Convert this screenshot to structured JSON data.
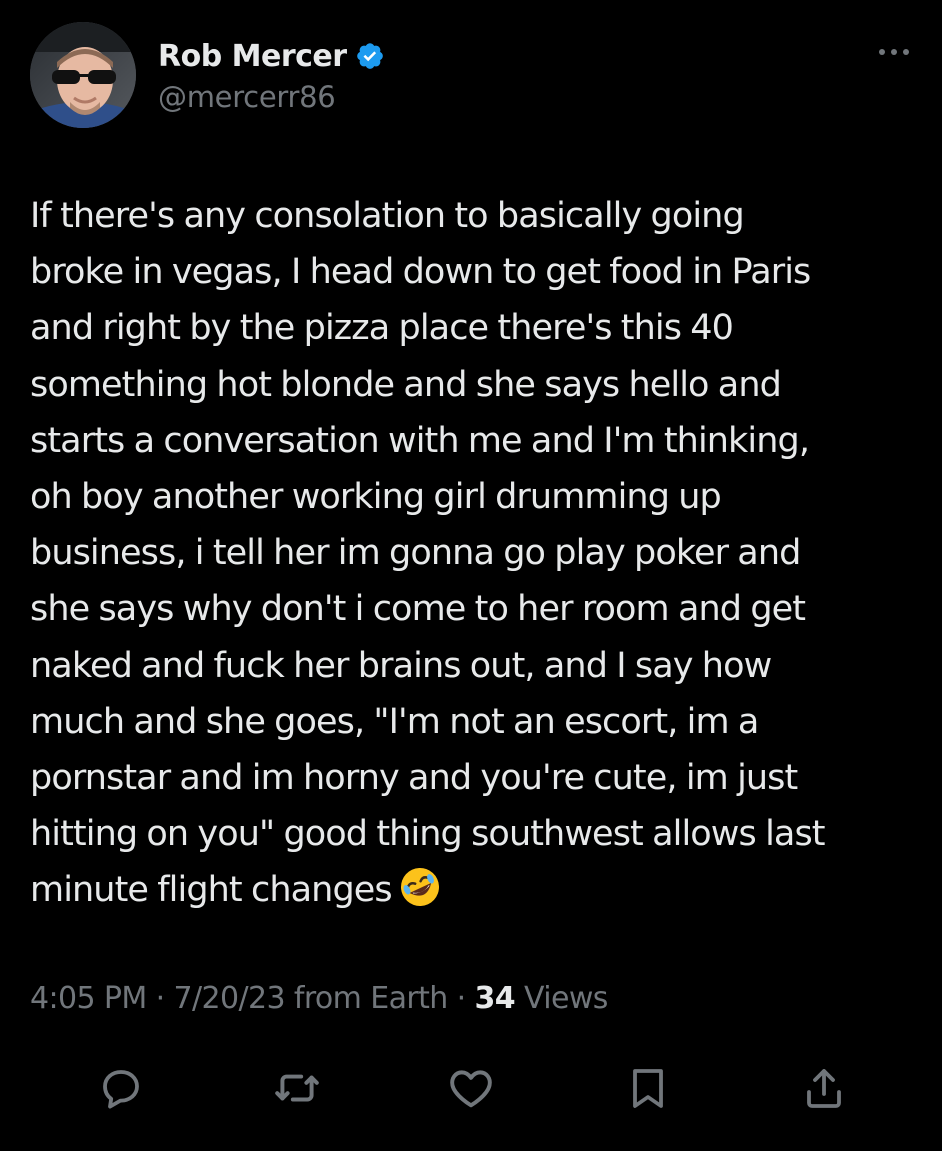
{
  "author": {
    "display_name": "Rob Mercer",
    "handle": "@mercerr86",
    "verified": true,
    "verified_color": "#1d9bf0"
  },
  "tweet": {
    "lines": [
      "If there's any consolation to basically going",
      "broke in vegas, I head down to get food in Paris",
      "and right by the pizza place there's this 40",
      "something hot blonde and she says hello and",
      "starts a conversation with me and I'm thinking,",
      "oh boy another working girl drumming up",
      "business, i tell her im gonna go play poker and",
      "she says why don't i come to her room and get",
      "naked and fuck her brains out, and I say how",
      "much and she goes, \"I'm not an escort, im a",
      "pornstar and im horny and you're cute, im just",
      "hitting on you\" good thing southwest allows last",
      "minute flight changes"
    ],
    "emoji": "rolling-on-the-floor-laughing-emoji"
  },
  "meta": {
    "time": "4:05 PM",
    "separator": "·",
    "date": "7/20/23",
    "source": "from Earth",
    "views_count": "34",
    "views_label": "Views"
  },
  "actions": {
    "icons": [
      "reply-icon",
      "retweet-icon",
      "like-icon",
      "bookmark-icon",
      "share-icon"
    ],
    "icon_color": "#71767b"
  },
  "colors": {
    "background": "#000000",
    "text": "#e7e9ea",
    "secondary": "#71767b"
  }
}
